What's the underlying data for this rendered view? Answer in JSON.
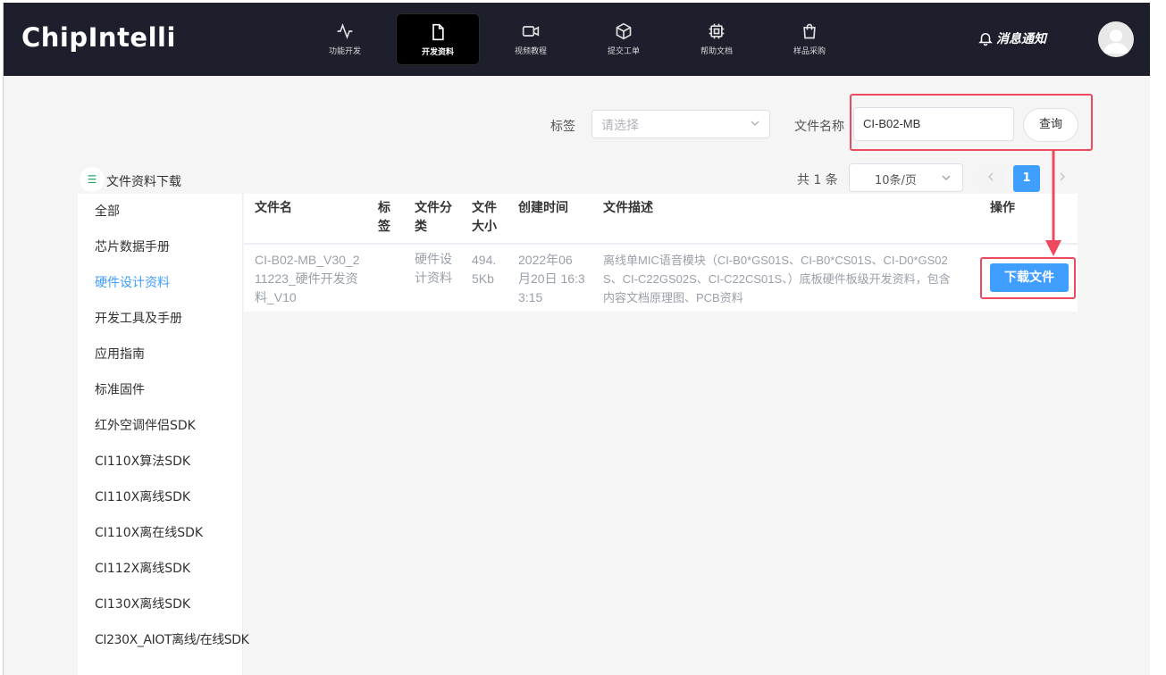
{
  "header": {
    "logo": "ChipIntelli",
    "nav": [
      {
        "label": "功能开发",
        "icon": "activity-icon"
      },
      {
        "label": "开发资料",
        "icon": "file-icon",
        "active": true
      },
      {
        "label": "视频教程",
        "icon": "video-icon"
      },
      {
        "label": "提交工单",
        "icon": "box-icon"
      },
      {
        "label": "帮助文档",
        "icon": "cpu-icon"
      },
      {
        "label": "样品采购",
        "icon": "shopping-bag-icon"
      }
    ],
    "notify_label": "消息通知"
  },
  "filter": {
    "tag_label": "标签",
    "tag_placeholder": "请选择",
    "filename_label": "文件名称",
    "filename_value": "CI-B02-MB",
    "query_label": "查询"
  },
  "section": {
    "title": "文件资料下载"
  },
  "pagination": {
    "total": "共 1 条",
    "page_size": "10条/页",
    "current_page": "1"
  },
  "sidebar": {
    "items": [
      "全部",
      "芯片数据手册",
      "硬件设计资料",
      "开发工具及手册",
      "应用指南",
      "标准固件",
      "红外空调伴侣SDK",
      "CI110X算法SDK",
      "CI110X离线SDK",
      "CI110X离在线SDK",
      "CI112X离线SDK",
      "CI130X离线SDK",
      "CI230X_AIOT离线/在线SDK"
    ],
    "active_index": 2
  },
  "table": {
    "headers": {
      "name": "文件名",
      "tag": [
        "标",
        "签"
      ],
      "category": [
        "文件分",
        "类"
      ],
      "size": [
        "文件",
        "大小"
      ],
      "created": "创建时间",
      "desc": "文件描述",
      "action": "操作"
    },
    "row": {
      "name": [
        "CI-B02-MB_V30_2",
        "11223_硬件开发资",
        "料_V10"
      ],
      "category": [
        "硬件设",
        "计资料"
      ],
      "size": [
        "494.",
        "5Kb"
      ],
      "created": [
        "2022年06",
        "月20日 16:3",
        "3:15"
      ],
      "desc": [
        "离线单MIC语音模块（CI-B0*GS01S、CI-B0*CS01S、CI-D0*GS02",
        "S、CI-C22GS02S、CI-C22CS01S、）底板硬件板级开发资料，包含",
        "内容文档原理图、PCB资料"
      ],
      "action": "下载文件"
    }
  },
  "colors": {
    "nav_bg": "#1d1f2d",
    "accent": "#409eff",
    "highlight": "#ef4960"
  }
}
